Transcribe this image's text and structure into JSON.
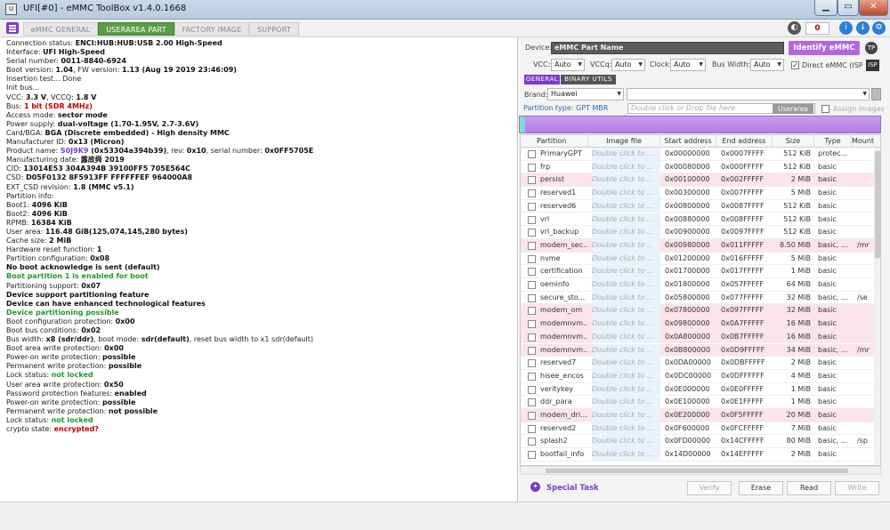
{
  "window": {
    "title": "UFI[#0] - eMMC ToolBox v1.4.0.1668",
    "app_icon": "U"
  },
  "tabs": [
    "eMMC GENERAL",
    "USERAREA PART",
    "FACTORY IMAGE",
    "SUPPORT"
  ],
  "toolbar": {
    "counter": "0"
  },
  "log": {
    "connection": {
      "label": "Connection status: ",
      "value": "ENCI:HUB:HUB:USB 2.00 High-Speed"
    },
    "interface": {
      "label": "Interface: ",
      "value": "UFI High-Speed"
    },
    "serial": {
      "label": "Serial number: ",
      "value": "0011-8840-6924"
    },
    "boot": {
      "label": " Boot version: ",
      "value": "1.04",
      "mid": ", FW version: ",
      "value2": "1.13 (Aug 19 2019 23:46:09)"
    },
    "insertion": "Insertion test... Done",
    "initbus": "Init bus...",
    "vcc": {
      "label": "VCC: ",
      "value": "3.3 V",
      "mid": ", VCCQ: ",
      "value2": "1.8 V"
    },
    "bus": {
      "label": "Bus: ",
      "value": "1 bit (SDR 4MHz)"
    },
    "access": {
      "label": "Access mode: ",
      "value": "sector mode"
    },
    "power": {
      "label": "Power supply: ",
      "value": "dual-voltage (1.70-1.95V, 2.7-3.6V)"
    },
    "cardbga": {
      "label": " Card/BGA: ",
      "value": "BGA (Discrete embedded) - High density MMC"
    },
    "manuf": {
      "label": " Manufacturer ID: ",
      "value": "0x13 (Micron)"
    },
    "product": {
      "label": " Product name: ",
      "value": "S0J9K9",
      "v2": " (0x53304a394b39)",
      "mid": ", rev: ",
      "v3": "0x10",
      "mid2": ", serial number: ",
      "v4": "0x0FF5705E"
    },
    "mdate": {
      "label": " Manufacturing date: ",
      "value": "露故舜  2019"
    },
    "cid": {
      "label": "CID: ",
      "value": "13014E53 304A394B 39100FF5 705E564C"
    },
    "csd": {
      "label": "CSD: ",
      "value": "D05F0132 8F5913FF FFFFFFEF 964000A8"
    },
    "extcsd": {
      "label": "EXT_CSD revision: ",
      "value": "1.8 (MMC v5.1)"
    },
    "partinfo": "Partition info:",
    "boot1": {
      "label": " Boot1: ",
      "value": "4096 KiB"
    },
    "boot2": {
      "label": " Boot2: ",
      "value": "4096 KiB"
    },
    "rpmb": {
      "label": " RPMB: ",
      "value": "16384 KiB"
    },
    "userarea": {
      "label": " User area: ",
      "value": "116.48 GiB(125,074,145,280 bytes)"
    },
    "cache": {
      "label": "Cache size: ",
      "value": "2 MiB"
    },
    "hwreset": {
      "label": "Hardware reset function: ",
      "value": "1"
    },
    "partconf": {
      "label": "Partition configuration: ",
      "value": "0x08"
    },
    "noack": " No boot acknowledge is sent (default)",
    "bootp1": " Boot partition 1 is enabled for boot",
    "partsupport": {
      "label": "Partitioning support: ",
      "value": "0x07"
    },
    "devsupport": " Device support partitioning feature",
    "devenh": " Device can have enhanced technological features",
    "devpart": " Device partitioning possible",
    "bootconfprot": {
      "label": "Boot configuration protection: ",
      "value": "0x00"
    },
    "bootbuscond": {
      "label": "Boot bus conditions: ",
      "value": "0x02"
    },
    "buswidth": {
      "label": " Bus width: ",
      "value": "x8 (sdr/ddr)",
      "mid": ", boot mode: ",
      "v2": "sdr(default)",
      "tail": ", reset bus width to x1 sdr(default)"
    },
    "bootwp": {
      "label": "Boot area write protection: ",
      "value": "0x00"
    },
    "powon1": {
      "label": " Power-on write protection: ",
      "value": "possible"
    },
    "perm1": {
      "label": " Permanent write protection: ",
      "value": "possible"
    },
    "lock1": {
      "label": " Lock status: ",
      "value": "not locked"
    },
    "userwp": {
      "label": "User area write protection: ",
      "value": "0x50"
    },
    "pwdprot": {
      "label": " Password protection features: ",
      "value": "enabled"
    },
    "powon2": {
      "label": " Power-on write protection: ",
      "value": "possible"
    },
    "perm2": {
      "label": " Permanent write protection: ",
      "value": "not possible"
    },
    "lock2": {
      "label": " Lock status: ",
      "value": "not locked"
    },
    "crypto": {
      "label": "crypto state: ",
      "value": "encrypted?"
    }
  },
  "right": {
    "device_label": "Device:",
    "device_value": "eMMC Part Name",
    "identify": "Identify eMMC",
    "tp": "TP",
    "vcc_label": "VCC:",
    "vcc": "Auto",
    "vccq_label": "VCCq:",
    "vccq": "Auto",
    "clock_label": "Clock:",
    "clock": "Auto",
    "buswidth_label": "Bus Width:",
    "buswidth": "Auto",
    "direct_label": "Direct eMMC (ISP)",
    "isp": "ISP",
    "general_tab": "GENERAL",
    "binary_tab": "BINARY UTILS",
    "brand_label": "Brand:",
    "brand": "Huawei",
    "parttype_label": "Partition type: GPT MBR",
    "drop_placeholder": "Double click or Drop file here",
    "userarea_btn": "Userarea",
    "assign_label": "Assign images",
    "columns": [
      "Partition",
      "Image file",
      "Start address",
      "End address",
      "Size",
      "Type",
      "Mount p"
    ],
    "image_placeholder": "Double click to ...",
    "rows": [
      {
        "name": "PrimaryGPT",
        "start": "0x00000000",
        "end": "0x0007FFFF",
        "size": "512 KiB",
        "type": "protec...",
        "mount": "",
        "hl": false
      },
      {
        "name": "frp",
        "start": "0x00080000",
        "end": "0x000FFFFF",
        "size": "512 KiB",
        "type": "basic",
        "mount": "",
        "hl": false
      },
      {
        "name": "persist",
        "start": "0x00100000",
        "end": "0x002FFFFF",
        "size": "2 MiB",
        "type": "basic",
        "mount": "",
        "hl": true
      },
      {
        "name": "reserved1",
        "start": "0x00300000",
        "end": "0x007FFFFF",
        "size": "5 MiB",
        "type": "basic",
        "mount": "",
        "hl": false
      },
      {
        "name": "reserved6",
        "start": "0x00800000",
        "end": "0x0087FFFF",
        "size": "512 KiB",
        "type": "basic",
        "mount": "",
        "hl": false
      },
      {
        "name": "vrl",
        "start": "0x00880000",
        "end": "0x008FFFFF",
        "size": "512 KiB",
        "type": "basic",
        "mount": "",
        "hl": false
      },
      {
        "name": "vrl_backup",
        "start": "0x00900000",
        "end": "0x0097FFFF",
        "size": "512 KiB",
        "type": "basic",
        "mount": "",
        "hl": false
      },
      {
        "name": "modem_sec...",
        "start": "0x00980000",
        "end": "0x011FFFFF",
        "size": "8.50 MiB",
        "type": "basic, ...",
        "mount": "/mr",
        "hl": true
      },
      {
        "name": "nvme",
        "start": "0x01200000",
        "end": "0x016FFFFF",
        "size": "5 MiB",
        "type": "basic",
        "mount": "",
        "hl": false
      },
      {
        "name": "certification",
        "start": "0x01700000",
        "end": "0x017FFFFF",
        "size": "1 MiB",
        "type": "basic",
        "mount": "",
        "hl": false
      },
      {
        "name": "oeminfo",
        "start": "0x01800000",
        "end": "0x057FFFFF",
        "size": "64 MiB",
        "type": "basic",
        "mount": "",
        "hl": false
      },
      {
        "name": "secure_sto...",
        "start": "0x05800000",
        "end": "0x077FFFFF",
        "size": "32 MiB",
        "type": "basic, ...",
        "mount": "/se",
        "hl": false
      },
      {
        "name": "modem_om",
        "start": "0x07800000",
        "end": "0x097FFFFF",
        "size": "32 MiB",
        "type": "basic",
        "mount": "",
        "hl": true
      },
      {
        "name": "modemnvm...",
        "start": "0x09800000",
        "end": "0x0A7FFFFF",
        "size": "16 MiB",
        "type": "basic",
        "mount": "",
        "hl": true
      },
      {
        "name": "modemnvm...",
        "start": "0x0A800000",
        "end": "0x0B7FFFFF",
        "size": "16 MiB",
        "type": "basic",
        "mount": "",
        "hl": true
      },
      {
        "name": "modemnvm...",
        "start": "0x0B800000",
        "end": "0x0D9FFFFF",
        "size": "34 MiB",
        "type": "basic, ...",
        "mount": "/mr",
        "hl": true
      },
      {
        "name": "reserved7",
        "start": "0x0DA00000",
        "end": "0x0DBFFFFF",
        "size": "2 MiB",
        "type": "basic",
        "mount": "",
        "hl": false
      },
      {
        "name": "hisee_encos",
        "start": "0x0DC00000",
        "end": "0x0DFFFFFF",
        "size": "4 MiB",
        "type": "basic",
        "mount": "",
        "hl": false
      },
      {
        "name": "veritykey",
        "start": "0x0E000000",
        "end": "0x0E0FFFFF",
        "size": "1 MiB",
        "type": "basic",
        "mount": "",
        "hl": false
      },
      {
        "name": "ddr_para",
        "start": "0x0E100000",
        "end": "0x0E1FFFFF",
        "size": "1 MiB",
        "type": "basic",
        "mount": "",
        "hl": false
      },
      {
        "name": "modem_dri...",
        "start": "0x0E200000",
        "end": "0x0F5FFFFF",
        "size": "20 MiB",
        "type": "basic",
        "mount": "",
        "hl": true
      },
      {
        "name": "reserved2",
        "start": "0x0F600000",
        "end": "0x0FCFFFFF",
        "size": "7 MiB",
        "type": "basic",
        "mount": "",
        "hl": false
      },
      {
        "name": "splash2",
        "start": "0x0FD00000",
        "end": "0x14CFFFFF",
        "size": "80 MiB",
        "type": "basic, ...",
        "mount": "/sp",
        "hl": false
      },
      {
        "name": "bootfail_info",
        "start": "0x14D00000",
        "end": "0x14EFFFFF",
        "size": "2 MiB",
        "type": "basic",
        "mount": "",
        "hl": false
      }
    ],
    "special_task": "Special Task",
    "verify": "Verify",
    "erase": "Erase",
    "read": "Read",
    "write": "Write"
  }
}
